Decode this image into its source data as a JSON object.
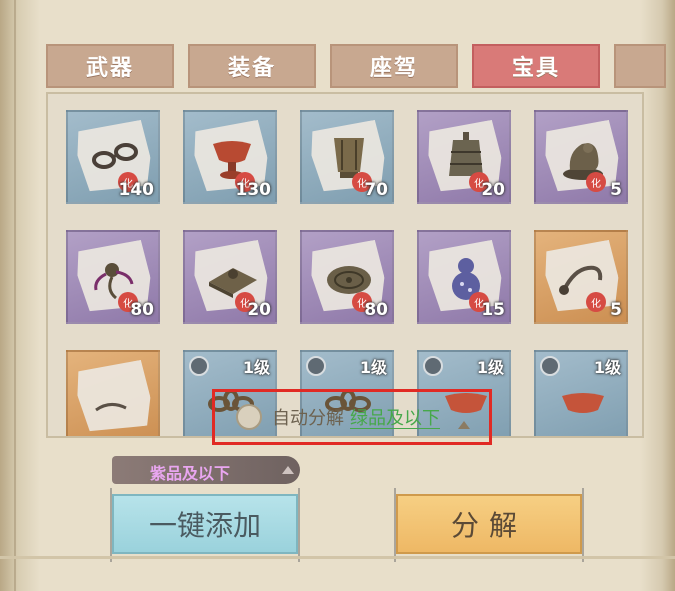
{
  "tabs": [
    {
      "label": "武器",
      "active": false
    },
    {
      "label": "装备",
      "active": false
    },
    {
      "label": "座驾",
      "active": false
    },
    {
      "label": "宝具",
      "active": true
    }
  ],
  "items": [
    {
      "rarity": "blue",
      "icon": "shackles-icon",
      "count": "140",
      "seal": "化"
    },
    {
      "rarity": "blue",
      "icon": "bronze-cup-icon",
      "count": "130",
      "seal": "化"
    },
    {
      "rarity": "blue",
      "icon": "bronze-vessel-icon",
      "count": "70",
      "seal": "化"
    },
    {
      "rarity": "purple",
      "icon": "bronze-bell-icon",
      "count": "20",
      "seal": "化"
    },
    {
      "rarity": "purple",
      "icon": "beast-statue-icon",
      "count": "5",
      "seal": "化"
    },
    {
      "rarity": "purple",
      "icon": "ornament-icon",
      "count": "80",
      "seal": "化"
    },
    {
      "rarity": "purple",
      "icon": "seal-tray-icon",
      "count": "20",
      "seal": "化"
    },
    {
      "rarity": "purple",
      "icon": "bronze-mirror-icon",
      "count": "80",
      "seal": "化"
    },
    {
      "rarity": "purple",
      "icon": "gourd-icon",
      "count": "15",
      "seal": "化"
    },
    {
      "rarity": "orange",
      "icon": "chain-whip-icon",
      "count": "5",
      "seal": "化"
    },
    {
      "rarity": "orange",
      "icon": "scroll-icon",
      "count": "",
      "seal": ""
    },
    {
      "rarity": "blue",
      "icon": "chain-icon",
      "level": "1级"
    },
    {
      "rarity": "blue",
      "icon": "chain-icon",
      "level": "1级"
    },
    {
      "rarity": "blue",
      "icon": "red-bowl-icon",
      "level": "1级"
    },
    {
      "rarity": "blue",
      "icon": "red-bowl-icon",
      "level": "1级"
    }
  ],
  "auto_decompose": {
    "label": "自动分解",
    "value": "绿品及以下",
    "checked": false
  },
  "filter": {
    "value": "紫品及以下"
  },
  "buttons": {
    "add": "一键添加",
    "decompose": "分解"
  },
  "colors": {
    "active_tab": "#d97a78",
    "highlight_border": "#e12a24",
    "green_text": "#46a84a",
    "purple_text": "#e9a6f0"
  }
}
